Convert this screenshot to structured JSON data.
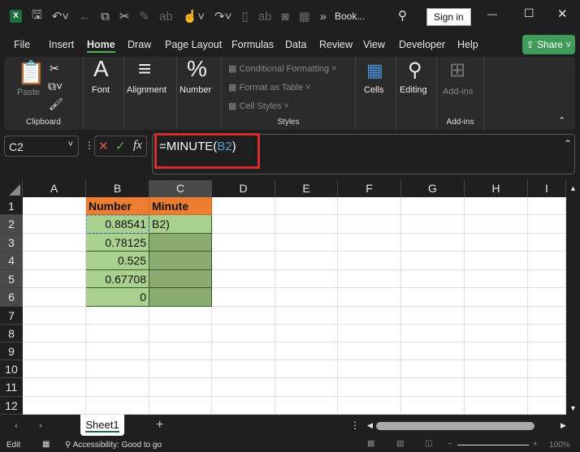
{
  "title_bar": {
    "title": "Book...",
    "sign_in": "Sign in",
    "app_icon": "excel-icon"
  },
  "menu": {
    "tabs": [
      "File",
      "Insert",
      "Home",
      "Draw",
      "Page Layout",
      "Formulas",
      "Data",
      "Review",
      "View",
      "Developer",
      "Help"
    ],
    "active": "Home",
    "share": "Share"
  },
  "ribbon": {
    "clipboard": {
      "paste": "Paste",
      "label": "Clipboard"
    },
    "font": "Font",
    "alignment": "Alignment",
    "number": "Number",
    "styles": {
      "conditional": "Conditional Formatting",
      "format_table": "Format as Table",
      "cell_styles": "Cell Styles",
      "label": "Styles"
    },
    "cells": "Cells",
    "editing": "Editing",
    "addins": {
      "button": "Add-ins",
      "label": "Add-ins"
    }
  },
  "formula_bar": {
    "name_box": "C2",
    "prefix": "=MINUTE(",
    "ref": "B2",
    "suffix": ")",
    "fx": "fx"
  },
  "columns": [
    "A",
    "B",
    "C",
    "D",
    "E",
    "F",
    "G",
    "H",
    "I"
  ],
  "rows": [
    "1",
    "2",
    "3",
    "4",
    "5",
    "6",
    "7",
    "8",
    "9",
    "10",
    "11",
    "12"
  ],
  "cells": {
    "B1": "Number",
    "C1": "Minute",
    "B2": "0.88541",
    "C2": "B2)",
    "B3": "0.78125",
    "B4": "0.525",
    "B5": "0.67708",
    "B6": "0"
  },
  "colors": {
    "header_fill": "#ed7d31",
    "data_fill": "#a9d08e",
    "selection_fill": "#8aab72",
    "ref_blue": "#5b9bd5",
    "highlight": "#d32f2f"
  },
  "sheets": {
    "tabs": [
      "Sheet1"
    ],
    "active": "Sheet1"
  },
  "status": {
    "mode": "Edit",
    "accessibility": "Accessibility: Good to go",
    "zoom": "100%"
  }
}
